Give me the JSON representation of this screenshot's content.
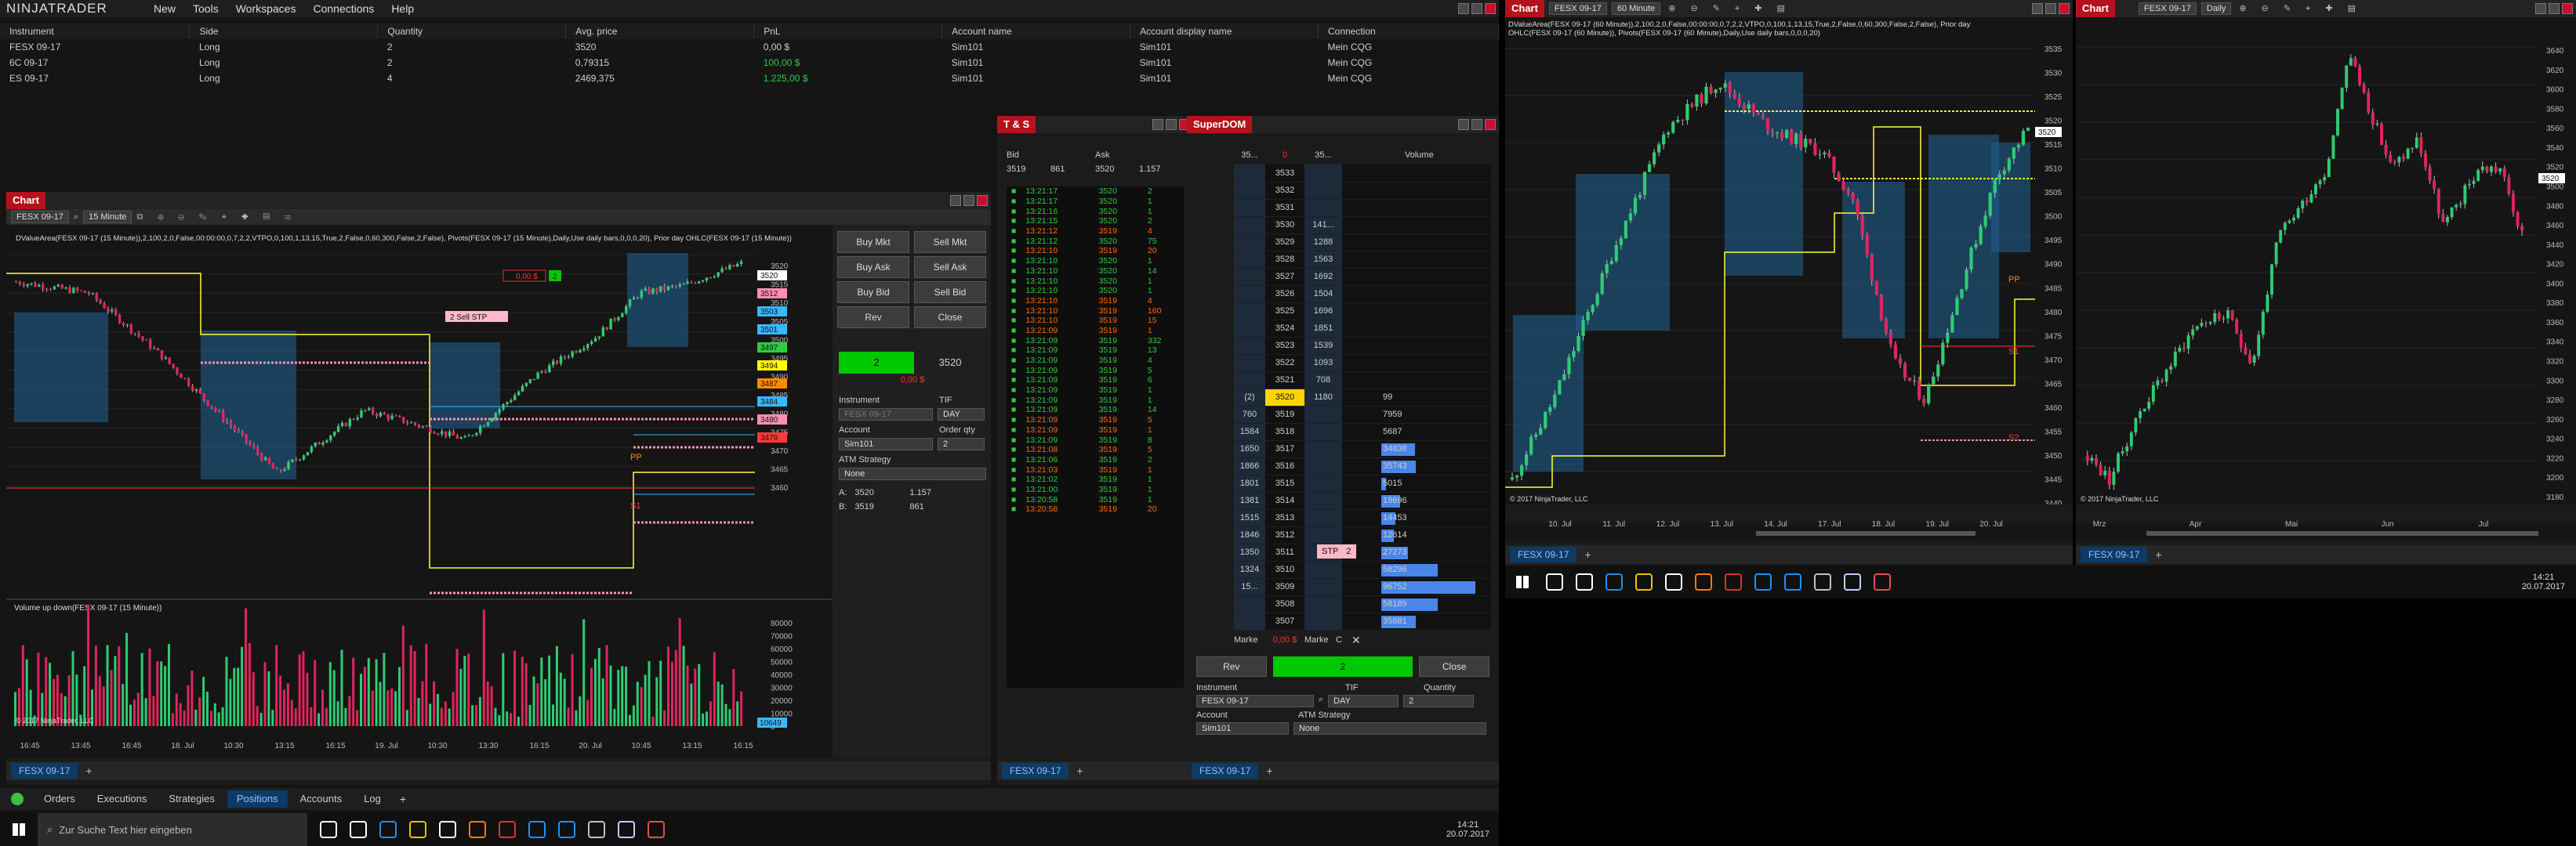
{
  "app": {
    "logo": "NINJATRADER",
    "menu": [
      "New",
      "Tools",
      "Workspaces",
      "Connections",
      "Help"
    ]
  },
  "positions": {
    "columns": [
      "Instrument",
      "Side",
      "Quantity",
      "Avg. price",
      "PnL",
      "Account name",
      "Account display name",
      "Connection"
    ],
    "rows": [
      [
        "FESX 09-17",
        "Long",
        "2",
        "3520",
        "0,00 $",
        "Sim101",
        "Sim101",
        "Mein CQG"
      ],
      [
        "6C 09-17",
        "Long",
        "2",
        "0,79315",
        "100,00 $",
        "Sim101",
        "Sim101",
        "Mein CQG"
      ],
      [
        "ES 09-17",
        "Long",
        "4",
        "2469,375",
        "1.225,00 $",
        "Sim101",
        "Sim101",
        "Mein CQG"
      ]
    ],
    "pnl_colors": [
      "#cfcfcf",
      "#2ecc40",
      "#2ecc40"
    ]
  },
  "bottom_tabs": [
    "Orders",
    "Executions",
    "Strategies",
    "Positions",
    "Accounts",
    "Log"
  ],
  "bottom_active": "Positions",
  "chart1": {
    "title": "Chart",
    "instrument": "FESX 09-17",
    "interval": "15 Minute",
    "header": "DValueArea(FESX 09-17 (15 Minute)),2,100,2,0,False,00:00:00,0,7,2,2,VTPO,0,100,1,13,15,True,2,False,0,60,300,False,2,False), Pivots(FESX 09-17 (15 Minute),Daily,Use daily bars,0,0,0,20), Prior day OHLC(FESX 09-17 (15 Minute))",
    "copyright": "© 2017 NinjaTrader, LLC",
    "volume_label": "Volume up down(FESX 09-17 (15 Minute))",
    "y_labels": [
      "3520",
      "3515",
      "3510",
      "3505",
      "3500",
      "3495",
      "3490",
      "3485",
      "3480",
      "3475",
      "3470",
      "3465",
      "3460"
    ],
    "vol_labels": [
      "80000",
      "70000",
      "60000",
      "50000",
      "40000",
      "30000",
      "20000",
      "10000",
      "0"
    ],
    "vol_current": "10649",
    "x_labels": [
      "16:45",
      "13:45",
      "16:45",
      "18. Jul",
      "10:30",
      "13:15",
      "16:15",
      "19. Jul",
      "10:30",
      "13:30",
      "16:15",
      "20. Jul",
      "10:45",
      "13:15",
      "16:15"
    ],
    "price_tags": [
      {
        "t": "3520",
        "c": "#ffffff"
      },
      {
        "t": "3512",
        "c": "#ff8fb0"
      },
      {
        "t": "3503",
        "c": "#39b7ff"
      },
      {
        "t": "3501",
        "c": "#39b7ff"
      },
      {
        "t": "3497",
        "c": "#2ecc40"
      },
      {
        "t": "3494",
        "c": "#ffff00"
      },
      {
        "t": "3487",
        "c": "#ff8c00"
      },
      {
        "t": "3484",
        "c": "#39b7ff"
      },
      {
        "t": "3480",
        "c": "#ff8fb0"
      },
      {
        "t": "3479",
        "c": "#ff3a3a"
      }
    ],
    "pp_label": "PP",
    "s1_label": "S1",
    "order_tag": "2  Sell STP",
    "pnl_tag": "0,00 $",
    "pnl_tag2": "2",
    "tab": "FESX 09-17"
  },
  "chart_trader": {
    "buttons": [
      "Buy Mkt",
      "Sell Mkt",
      "Buy Ask",
      "Sell Ask",
      "Buy Bid",
      "Sell Bid",
      "Rev",
      "Close"
    ],
    "position_qty": "2",
    "position_price": "3520",
    "position_pnl": "0,00 $",
    "instrument_label": "Instrument",
    "instrument": "FESX 09-17",
    "tif_label": "TIF",
    "tif": "DAY",
    "account_label": "Account",
    "account": "Sim101",
    "qty_label": "Order qty",
    "qty": "2",
    "atm_label": "ATM Strategy",
    "atm": "None",
    "ask_label": "A:",
    "ask": "3520",
    "ask_size": "1.157",
    "bid_label": "B:",
    "bid": "3519",
    "bid_size": "861"
  },
  "ts": {
    "title": "T & S",
    "cols": [
      "Bid",
      "Ask"
    ],
    "bid": "3519",
    "bid_size": "861",
    "ask": "3520",
    "ask_size": "1.157",
    "rows": [
      [
        "13:21:17",
        "3520",
        "2",
        "#2ecc40"
      ],
      [
        "13:21:17",
        "3520",
        "1",
        "#2ecc40"
      ],
      [
        "13:21:16",
        "3520",
        "1",
        "#2ecc40"
      ],
      [
        "13:21:15",
        "3520",
        "2",
        "#2ecc40"
      ],
      [
        "13:21:12",
        "3519",
        "4",
        "#ff6a00"
      ],
      [
        "13:21:12",
        "3520",
        "75",
        "#2ecc40"
      ],
      [
        "13:21:10",
        "3519",
        "20",
        "#ff6a00"
      ],
      [
        "13:21:10",
        "3520",
        "1",
        "#2ecc40"
      ],
      [
        "13:21:10",
        "3520",
        "14",
        "#2ecc40"
      ],
      [
        "13:21:10",
        "3520",
        "1",
        "#2ecc40"
      ],
      [
        "13:21:10",
        "3520",
        "1",
        "#2ecc40"
      ],
      [
        "13:21:10",
        "3519",
        "4",
        "#ff6a00"
      ],
      [
        "13:21:10",
        "3519",
        "160",
        "#ff6a00"
      ],
      [
        "13:21:10",
        "3519",
        "15",
        "#ff6a00"
      ],
      [
        "13:21:09",
        "3519",
        "1",
        "#ff6a00"
      ],
      [
        "13:21:09",
        "3519",
        "332",
        "#2ecc40"
      ],
      [
        "13:21:09",
        "3519",
        "13",
        "#2ecc40"
      ],
      [
        "13:21:09",
        "3519",
        "4",
        "#2ecc40"
      ],
      [
        "13:21:09",
        "3519",
        "5",
        "#2ecc40"
      ],
      [
        "13:21:09",
        "3519",
        "6",
        "#2ecc40"
      ],
      [
        "13:21:09",
        "3519",
        "1",
        "#2ecc40"
      ],
      [
        "13:21:09",
        "3519",
        "1",
        "#2ecc40"
      ],
      [
        "13:21:09",
        "3519",
        "14",
        "#2ecc40"
      ],
      [
        "13:21:09",
        "3519",
        "5",
        "#ff6a00"
      ],
      [
        "13:21:09",
        "3519",
        "1",
        "#ff6a00"
      ],
      [
        "13:21:09",
        "3519",
        "8",
        "#2ecc40"
      ],
      [
        "13:21:08",
        "3519",
        "5",
        "#ff6a00"
      ],
      [
        "13:21:06",
        "3519",
        "2",
        "#2ecc40"
      ],
      [
        "13:21:03",
        "3519",
        "1",
        "#ff6a00"
      ],
      [
        "13:21:02",
        "3519",
        "1",
        "#2ecc40"
      ],
      [
        "13:21:00",
        "3519",
        "1",
        "#2ecc40"
      ],
      [
        "13:20:58",
        "3519",
        "1",
        "#2ecc40"
      ],
      [
        "13:20:58",
        "3519",
        "20",
        "#ff6a00"
      ]
    ],
    "tab": "FESX 09-17"
  },
  "dom": {
    "title": "SuperDOM",
    "col_left": "35...",
    "col_center": "0",
    "col_right": "35...",
    "vol_label": "Volume",
    "rows": [
      [
        "",
        "3533",
        "",
        ""
      ],
      [
        "",
        "3532",
        "",
        ""
      ],
      [
        "",
        "3531",
        "",
        ""
      ],
      [
        "",
        "3530",
        "141...",
        ""
      ],
      [
        "",
        "3529",
        "1288",
        ""
      ],
      [
        "",
        "3528",
        "1563",
        ""
      ],
      [
        "",
        "3527",
        "1692",
        ""
      ],
      [
        "",
        "3526",
        "1504",
        ""
      ],
      [
        "",
        "3525",
        "1696",
        ""
      ],
      [
        "",
        "3524",
        "1851",
        ""
      ],
      [
        "",
        "3523",
        "1539",
        ""
      ],
      [
        "",
        "3522",
        "1093",
        ""
      ],
      [
        "",
        "3521",
        "708",
        ""
      ],
      [
        "(2)",
        "3520",
        "1180",
        "99"
      ],
      [
        "760",
        "3519",
        "",
        "7959"
      ],
      [
        "1584",
        "3518",
        "",
        "5687"
      ],
      [
        "1650",
        "3517",
        "",
        "34838"
      ],
      [
        "1866",
        "3516",
        "",
        "35743"
      ],
      [
        "1801",
        "3515",
        "",
        "5015"
      ],
      [
        "1381",
        "3514",
        "",
        "19696"
      ],
      [
        "1515",
        "3513",
        "",
        "14453"
      ],
      [
        "1846",
        "3512",
        "",
        "12614"
      ],
      [
        "1350",
        "3511",
        "",
        "27273"
      ],
      [
        "1324",
        "3510",
        "",
        "58296"
      ],
      [
        "15...",
        "3509",
        "",
        "96752"
      ],
      [
        "",
        "3508",
        "",
        "58189"
      ],
      [
        "",
        "3507",
        "",
        "35881"
      ]
    ],
    "vol_pct": [
      0,
      0,
      0,
      0,
      0,
      0,
      0,
      0,
      0,
      0,
      0,
      0,
      0,
      0,
      0,
      0,
      0.36,
      0.37,
      0.05,
      0.2,
      0.15,
      0.13,
      0.28,
      0.6,
      1.0,
      0.6,
      0.37
    ],
    "stp": "STP",
    "stp_qty": "2",
    "market_left": "Marke",
    "pnl": "0,00 $",
    "market_right": "Marke",
    "c_label": "C",
    "rev": "Rev",
    "pos": "2",
    "close": "Close",
    "instrument_label": "Instrument",
    "instrument": "FESX 09-17",
    "tif_label": "TIF",
    "tif": "DAY",
    "qty_label": "Quantity",
    "qty": "2",
    "account_label": "Account",
    "account": "Sim101",
    "atm_label": "ATM Strategy",
    "atm": "None",
    "tab": "FESX 09-17"
  },
  "chart2": {
    "title": "Chart",
    "instrument": "FESX 09-17",
    "interval": "60 Minute",
    "header": "DValueArea(FESX 09-17 (60 Minute)),2,100,2,0,False,00:00:00,0,7,2,2,VTPO,0,100,1,13,15,True,2,False,0,60,300,False,2,False), Prior day OHLC(FESX 09-17 (60 Minute)), Pivots(FESX 09-17 (60 Minute),Daily,Use daily bars,0,0,0,20)",
    "y_labels": [
      "3535",
      "3530",
      "3525",
      "3520",
      "3515",
      "3510",
      "3505",
      "3500",
      "3495",
      "3490",
      "3485",
      "3480",
      "3475",
      "3470",
      "3465",
      "3460",
      "3455",
      "3450",
      "3445",
      "3440"
    ],
    "x_labels": [
      "10. Jul",
      "11. Jul",
      "12. Jul",
      "13. Jul",
      "14. Jul",
      "17. Jul",
      "18. Jul",
      "19. Jul",
      "20. Jul"
    ],
    "copyright": "© 2017 NinjaTrader, LLC",
    "pp_label": "PP",
    "s1_label": "S1",
    "s2_label": "S2",
    "tab": "FESX 09-17",
    "last": "3520"
  },
  "chart3": {
    "title": "Chart",
    "instrument": "FESX 09-17",
    "interval": "Daily",
    "y_labels": [
      "3640",
      "3620",
      "3600",
      "3580",
      "3560",
      "3540",
      "3520",
      "3500",
      "3480",
      "3460",
      "3440",
      "3420",
      "3400",
      "3380",
      "3360",
      "3340",
      "3320",
      "3300",
      "3280",
      "3260",
      "3240",
      "3220",
      "3200",
      "3180"
    ],
    "x_labels": [
      "Mrz",
      "Apr",
      "Mai",
      "Jun",
      "Jul"
    ],
    "copyright": "© 2017 NinjaTrader, LLC",
    "tab": "FESX 09-17",
    "last": "3520"
  },
  "taskbar": {
    "search": "Zur Suche Text hier eingeben",
    "time": "14:21",
    "date": "20.07.2017"
  },
  "taskbar2": {
    "time": "14:21",
    "date": "20.07.2017"
  }
}
